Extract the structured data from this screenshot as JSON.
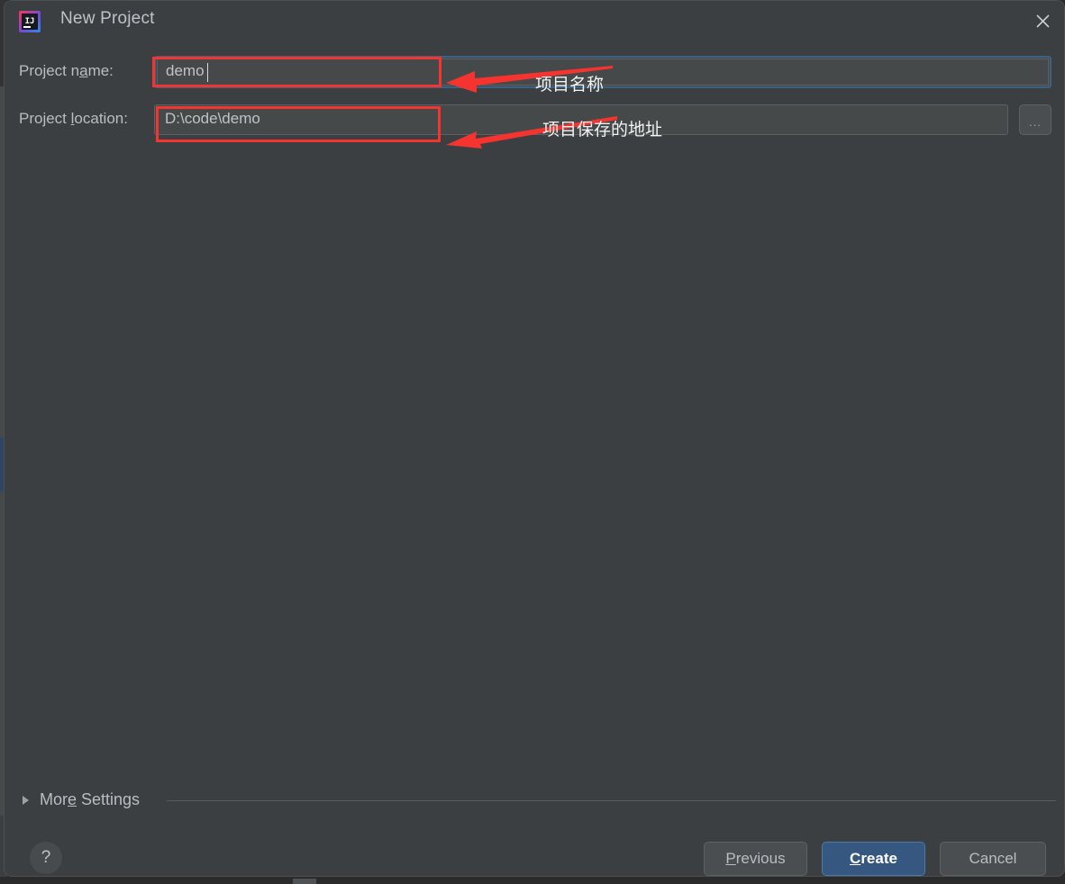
{
  "window": {
    "title": "New Project",
    "app_icon": "intellij-idea-icon",
    "icon_text": "IJ",
    "close_icon": "close-icon"
  },
  "form": {
    "name_label_pre": "Project n",
    "name_label_mn": "a",
    "name_label_post": "me:",
    "name_value": "demo",
    "name_placeholder": "Project name",
    "location_label_pre": "Project ",
    "location_label_mn": "l",
    "location_label_post": "ocation:",
    "location_value": "D:\\code\\demo",
    "location_placeholder": "Project location",
    "browse_label": "...",
    "browse_icon": "ellipsis-icon"
  },
  "annotations": [
    {
      "name": "project-name-annotation",
      "text": "项目名称",
      "arrow": "arrow-left-icon",
      "color": "#f5332f"
    },
    {
      "name": "project-location-annotation",
      "text": "项目保存的地址",
      "arrow": "arrow-left-icon",
      "color": "#f5332f"
    }
  ],
  "more_settings": {
    "label_pre": "Mor",
    "label_mn": "e",
    "label_post": " Settings",
    "expander_icon": "triangle-right-icon",
    "expanded": false
  },
  "footer": {
    "help_icon": "question-mark-icon",
    "previous_pre": "",
    "previous_mn": "P",
    "previous_post": "revious",
    "create_pre": "",
    "create_mn": "C",
    "create_post": "reate",
    "cancel_label": "Cancel"
  },
  "colors": {
    "dialog_background": "#3c3f41",
    "field_background": "#45494a",
    "focus_border": "#3d6185",
    "primary_button": "#365880",
    "annotation_red": "#f5332f",
    "text": "#b9bdc1"
  }
}
